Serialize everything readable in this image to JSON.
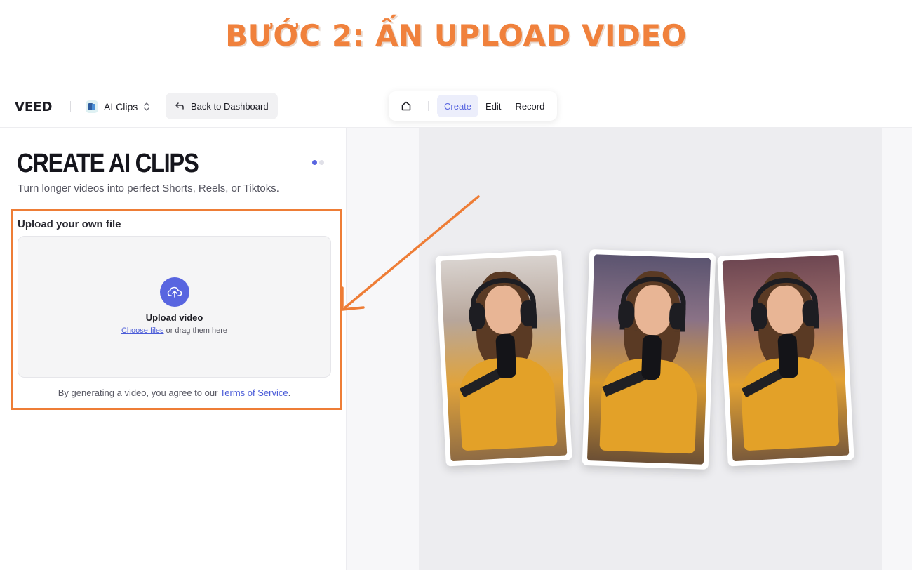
{
  "banner": {
    "text": "BƯỚC 2: ẤN UPLOAD VIDEO",
    "color": "#f0813c"
  },
  "topbar": {
    "logo": "VEED",
    "product_selector": {
      "label": "AI Clips",
      "icon": "ai-clips-icon"
    },
    "back_button": {
      "label": "Back to Dashboard",
      "icon": "arrow-back-icon"
    },
    "mode_tabs": {
      "home_icon": "home-icon",
      "create": "Create",
      "edit": "Edit",
      "record": "Record",
      "active": "Create"
    }
  },
  "left_panel": {
    "title": "CREATE AI CLIPS",
    "subtitle": "Turn longer videos into perfect Shorts, Reels, or Tiktoks.",
    "step_dots": {
      "total": 2,
      "current": 1
    },
    "upload": {
      "section_label": "Upload your own file",
      "title": "Upload video",
      "choose_link": "Choose files",
      "hint_suffix": " or drag them here",
      "icon": "cloud-upload-icon"
    },
    "terms": {
      "prefix": "By generating a video, you agree to our ",
      "link": "Terms of Service",
      "suffix": "."
    }
  },
  "annotation": {
    "highlight_color": "#ee7d36",
    "arrow_color": "#ee7d36"
  },
  "preview": {
    "cards": [
      {
        "label": "podcast-clip-1"
      },
      {
        "label": "podcast-clip-2"
      },
      {
        "label": "podcast-clip-3"
      }
    ]
  },
  "colors": {
    "accent": "#5865e0",
    "link": "#4a5bd8"
  }
}
